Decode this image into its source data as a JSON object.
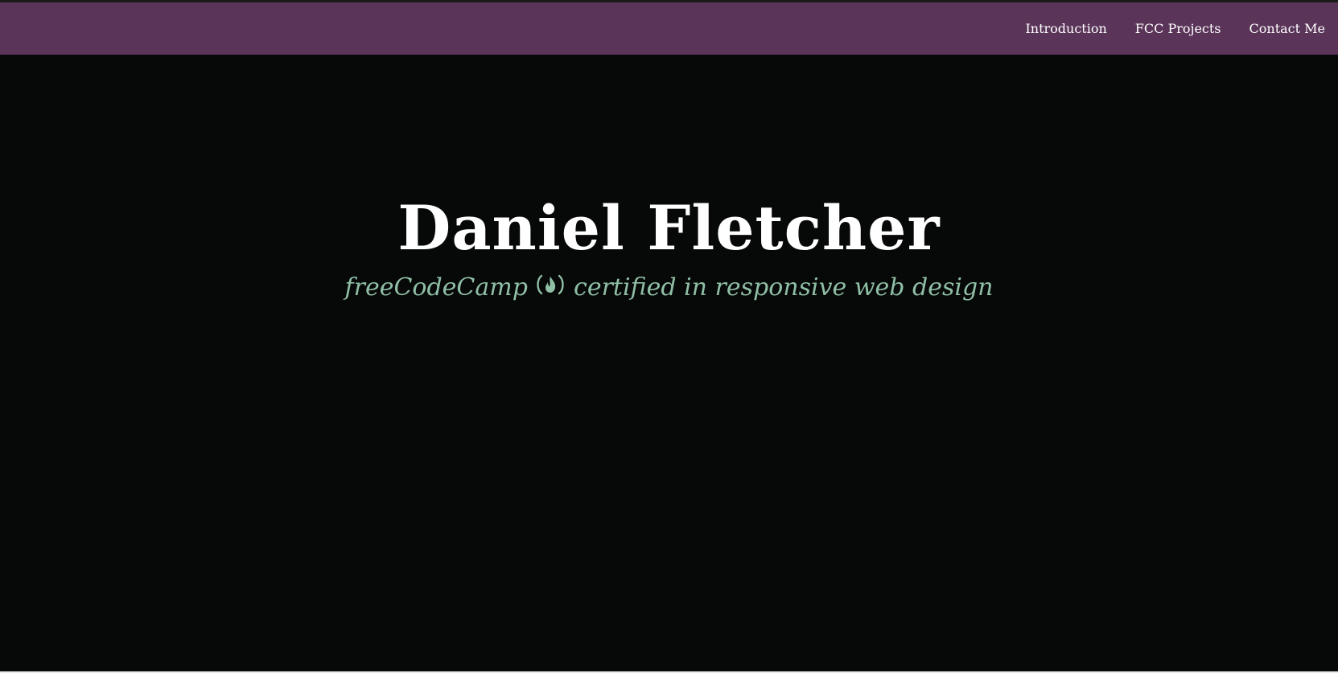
{
  "nav": {
    "links": [
      {
        "label": "Introduction"
      },
      {
        "label": "FCC Projects"
      },
      {
        "label": "Contact Me"
      }
    ]
  },
  "hero": {
    "title": "Daniel Fletcher",
    "subtitle_before": "freeCodeCamp",
    "icon": "free-code-camp-icon",
    "subtitle_after": "certified in responsive web design"
  },
  "colors": {
    "navbar": "#5a3559",
    "hero_background": "#070808",
    "title": "#ffffff",
    "subtitle": "#8fbfa5"
  }
}
